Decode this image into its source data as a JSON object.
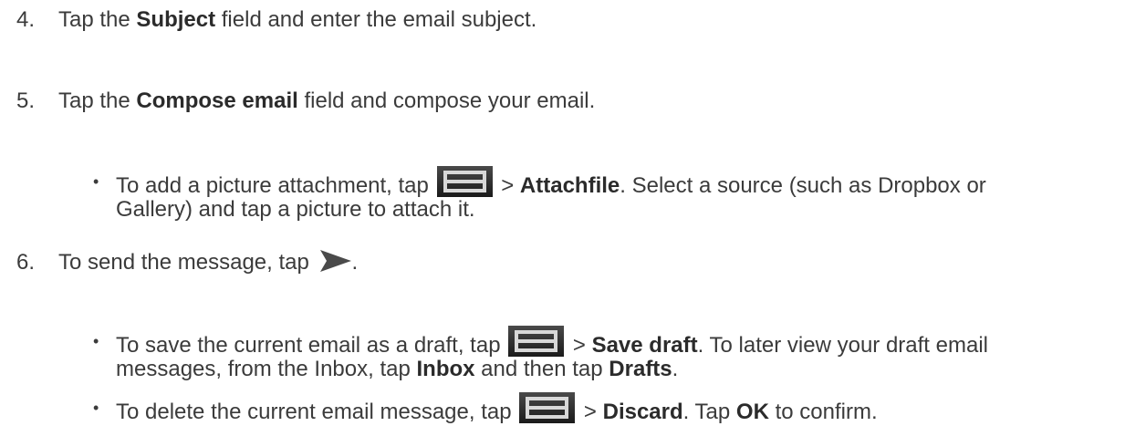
{
  "steps": [
    {
      "number": "4.",
      "parts": [
        "Tap the ",
        "Subject",
        " field and enter the email subject."
      ]
    },
    {
      "number": "5.",
      "parts": [
        "Tap the ",
        "Compose email",
        " field and compose your email."
      ],
      "bullets": [
        {
          "line1": [
            "To add a picture attachment, tap ",
            " > ",
            "Attachfile",
            ". Select a source (such as Dropbox or"
          ],
          "line2": "Gallery) and tap a picture to attach it."
        }
      ]
    },
    {
      "number": "6.",
      "parts": [
        "To send the message, tap ",
        "."
      ],
      "bullets": [
        {
          "line1": [
            "To save the current email as a draft, tap ",
            " > ",
            "Save draft",
            ". To later view your draft email"
          ],
          "line2": [
            "messages, from the Inbox, tap ",
            "Inbox",
            " and then tap ",
            "Drafts",
            "."
          ]
        },
        {
          "line1": [
            "To delete the current email message, tap ",
            " > ",
            "Discard",
            ". Tap ",
            "OK",
            " to confirm."
          ]
        }
      ]
    }
  ],
  "icons": {
    "menu": "menu-icon",
    "send": "send-icon"
  },
  "bullet_char": "•"
}
